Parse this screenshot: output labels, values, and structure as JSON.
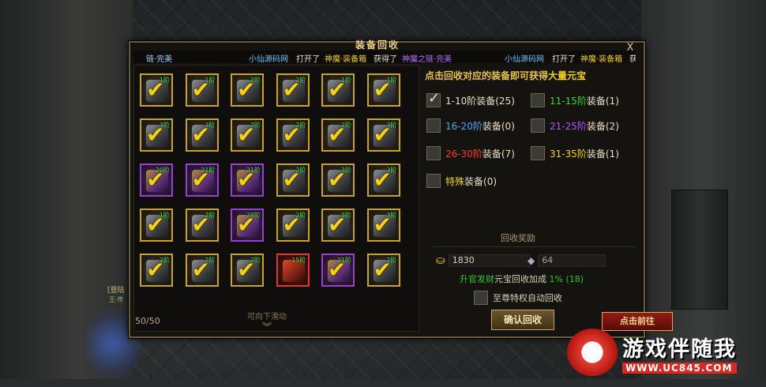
{
  "panel": {
    "title": "装备回收",
    "close": "X"
  },
  "ticker": [
    {
      "text": "链·完美",
      "color": "#9ad4ff"
    },
    {
      "text": "小仙源码网",
      "color": "#6fc0ff"
    },
    {
      "text": "打开了",
      "color": "#e8e0c8"
    },
    {
      "text": "神魔·装备箱",
      "color": "#f3d11a"
    },
    {
      "text": "获得了",
      "color": "#e8e0c8"
    },
    {
      "text": "神魔之链·完美",
      "color": "#b070ff"
    },
    {
      "text": "小仙源码网",
      "color": "#6fc0ff"
    },
    {
      "text": "打开了",
      "color": "#e8e0c8"
    },
    {
      "text": "神魔·装备箱",
      "color": "#f3d11a"
    },
    {
      "text": "获得",
      "color": "#e8e0c8"
    }
  ],
  "grid": {
    "rows": [
      [
        {
          "lvl": "1阶",
          "t": "g"
        },
        {
          "lvl": "1阶",
          "t": "g"
        },
        {
          "lvl": "2阶",
          "t": "g"
        },
        {
          "lvl": "2阶",
          "t": "g"
        },
        {
          "lvl": "1阶",
          "t": "g"
        },
        {
          "lvl": "1阶",
          "t": "g"
        }
      ],
      [
        {
          "lvl": "3阶",
          "t": "g"
        },
        {
          "lvl": "3阶",
          "t": "g"
        },
        {
          "lvl": "2阶",
          "t": "g"
        },
        {
          "lvl": "2阶",
          "t": "g"
        },
        {
          "lvl": "2阶",
          "t": "g"
        },
        {
          "lvl": "3阶",
          "t": "g"
        }
      ],
      [
        {
          "lvl": "20阶",
          "t": "p"
        },
        {
          "lvl": "21阶",
          "t": "p"
        },
        {
          "lvl": "21阶",
          "t": "p"
        },
        {
          "lvl": "2阶",
          "t": "g"
        },
        {
          "lvl": "3阶",
          "t": "g"
        },
        {
          "lvl": "3阶",
          "t": "g"
        }
      ],
      [
        {
          "lvl": "1阶",
          "t": "g"
        },
        {
          "lvl": "2阶",
          "t": "g"
        },
        {
          "lvl": "28阶",
          "t": "p"
        },
        {
          "lvl": "2阶",
          "t": "g"
        },
        {
          "lvl": "3阶",
          "t": "g"
        },
        {
          "lvl": "3阶",
          "t": "g"
        }
      ],
      [
        {
          "lvl": "2阶",
          "t": "g"
        },
        {
          "lvl": "2阶",
          "t": "g"
        },
        {
          "lvl": "2阶",
          "t": "g"
        },
        {
          "lvl": "15阶",
          "t": "r"
        },
        {
          "lvl": "21阶",
          "t": "p"
        },
        {
          "lvl": "2阶",
          "t": "g"
        }
      ]
    ],
    "count": "50/50",
    "scroll_hint": "可向下滑动",
    "scroll_arrow": "︾"
  },
  "headline": {
    "main": "点击回收对应的装备即可获得",
    "highlight": "大量元宝"
  },
  "filters": [
    {
      "label": "1-10阶",
      "suffix": "装备(25)",
      "color": "#e8e0c8",
      "checked": true
    },
    {
      "label": "11-15阶",
      "suffix": "装备(1)",
      "color": "#33d233",
      "checked": false
    },
    {
      "label": "16-20阶",
      "suffix": "装备(0)",
      "color": "#4ea5ff",
      "checked": false
    },
    {
      "label": "21-25阶",
      "suffix": "装备(2)",
      "color": "#b055ff",
      "checked": false
    },
    {
      "label": "26-30阶",
      "suffix": "装备(7)",
      "color": "#ff3b2b",
      "checked": false
    },
    {
      "label": "31-35阶",
      "suffix": "装备(1)",
      "color": "#f3d11a",
      "checked": false
    },
    {
      "label": "特殊",
      "suffix": "装备(0)",
      "color": "#f3d11a",
      "checked": false
    }
  ],
  "reward": {
    "title": "回收奖励",
    "gold_value": "1830",
    "other_value": "64",
    "bonus_prefix": "升官发财",
    "bonus_text": "元宝回收加成",
    "bonus_value": "1% (18)"
  },
  "auto_recycle": {
    "label": "至尊特权自动回收",
    "checked": false
  },
  "confirm_label": "确认回收",
  "go_label": "点击前往",
  "scene": {
    "side_label": "[登陆",
    "side_label2": "王·传"
  },
  "watermark": {
    "title": "游戏伴随我",
    "url": "WWW.UC845.COM"
  }
}
